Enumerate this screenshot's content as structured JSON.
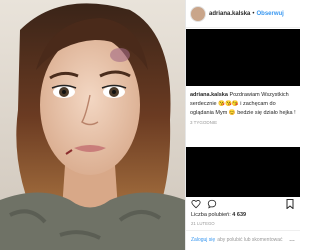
{
  "post": {
    "username": "adriana.kalska",
    "header_dot": "•",
    "follow_label": "Obserwuj",
    "caption_user": "adriana.kalska",
    "caption_text": "Pozdrawiam Wszystkich serdecznie 😘😘😘 i zachęcam do oglądania Mym 😊 bedzie się działo hejka !",
    "time_ago": "3 tygodnie",
    "likes_label": "Liczba polubień:",
    "likes_count": "4 639",
    "date": "21 lutego"
  },
  "footer": {
    "login_link": "Zaloguj się",
    "login_text": "aby polubić lub skomentować",
    "more_icon": "…"
  },
  "icons": {
    "like": "heart-icon",
    "comment": "comment-icon",
    "bookmark": "bookmark-icon"
  },
  "colors": {
    "link_blue": "#3897f0",
    "text": "#262626",
    "muted": "#999999",
    "redacted": "#000000"
  }
}
